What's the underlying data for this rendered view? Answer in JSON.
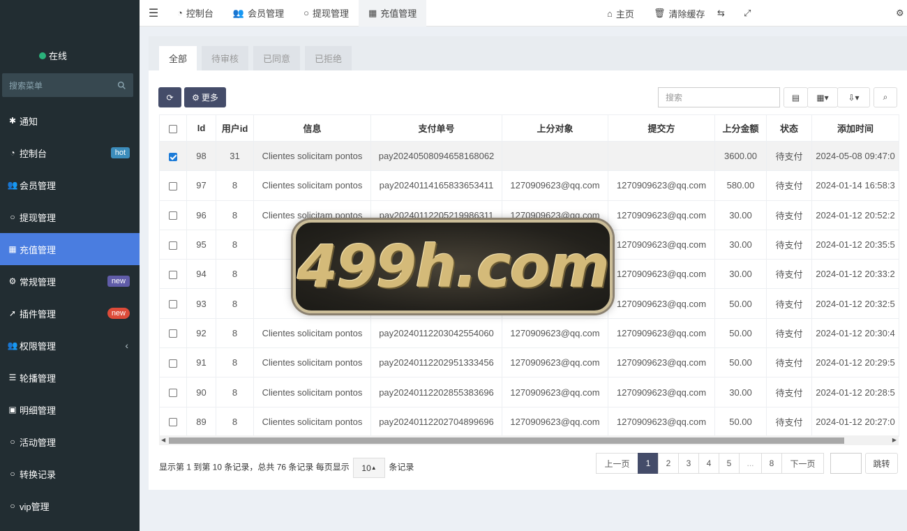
{
  "sidebar": {
    "status_label": "在线",
    "search_placeholder": "搜索菜单",
    "items": [
      {
        "label": "通知",
        "icon": "asterisk-icon"
      },
      {
        "label": "控制台",
        "icon": "dashboard-icon",
        "badge": "hot"
      },
      {
        "label": "会员管理",
        "icon": "users-icon"
      },
      {
        "label": "提现管理",
        "icon": "circle-icon"
      },
      {
        "label": "充值管理",
        "icon": "grid-icon",
        "active": true
      },
      {
        "label": "常规管理",
        "icon": "cogs-icon",
        "badge": "new"
      },
      {
        "label": "插件管理",
        "icon": "rocket-icon",
        "badge": "new"
      },
      {
        "label": "权限管理",
        "icon": "users-icon",
        "arrow": "‹"
      },
      {
        "label": "轮播管理",
        "icon": "list-icon"
      },
      {
        "label": "明细管理",
        "icon": "calendar-icon"
      },
      {
        "label": "活动管理",
        "icon": "circle-icon"
      },
      {
        "label": "转换记录",
        "icon": "circle-icon"
      },
      {
        "label": "vip管理",
        "icon": "circle-icon"
      }
    ]
  },
  "topbar": {
    "tabs": [
      "控制台",
      "会员管理",
      "提现管理",
      "充值管理"
    ],
    "home": "主页",
    "clear_cache": "清除缓存"
  },
  "panel": {
    "tabs": [
      "全部",
      "待审核",
      "已同意",
      "已拒绝"
    ],
    "more_button": "更多",
    "search_placeholder": "搜索"
  },
  "table": {
    "headers": [
      "Id",
      "用户id",
      "信息",
      "支付单号",
      "上分对象",
      "提交方",
      "上分金额",
      "状态",
      "添加时间"
    ],
    "rows": [
      {
        "id": "98",
        "uid": "31",
        "info": "Clientes solicitam pontos",
        "order": "pay20240508094658168062",
        "target": "",
        "submitter": "",
        "amount": "3600.00",
        "status": "待支付",
        "time": "2024-05-08 09:47:0",
        "checked": true
      },
      {
        "id": "97",
        "uid": "8",
        "info": "Clientes solicitam pontos",
        "order": "pay20240114165833653411",
        "target": "1270909623@qq.com",
        "submitter": "1270909623@qq.com",
        "amount": "580.00",
        "status": "待支付",
        "time": "2024-01-14 16:58:3"
      },
      {
        "id": "96",
        "uid": "8",
        "info": "Clientes solicitam pontos",
        "order": "pay20240112205219986311",
        "target": "1270909623@qq.com",
        "submitter": "1270909623@qq.com",
        "amount": "30.00",
        "status": "待支付",
        "time": "2024-01-12 20:52:2"
      },
      {
        "id": "95",
        "uid": "8",
        "info": "Cliente",
        "order": "",
        "target": "",
        "submitter": "1270909623@qq.com",
        "amount": "30.00",
        "status": "待支付",
        "time": "2024-01-12 20:35:5"
      },
      {
        "id": "94",
        "uid": "8",
        "info": "Cliente",
        "order": "",
        "target": "",
        "submitter": "1270909623@qq.com",
        "amount": "30.00",
        "status": "待支付",
        "time": "2024-01-12 20:33:2"
      },
      {
        "id": "93",
        "uid": "8",
        "info": "Clientes",
        "order": "",
        "target": "",
        "submitter": "1270909623@qq.com",
        "amount": "50.00",
        "status": "待支付",
        "time": "2024-01-12 20:32:5"
      },
      {
        "id": "92",
        "uid": "8",
        "info": "Clientes solicitam pontos",
        "order": "pay20240112203042554060",
        "target": "1270909623@qq.com",
        "submitter": "1270909623@qq.com",
        "amount": "50.00",
        "status": "待支付",
        "time": "2024-01-12 20:30:4"
      },
      {
        "id": "91",
        "uid": "8",
        "info": "Clientes solicitam pontos",
        "order": "pay20240112202951333456",
        "target": "1270909623@qq.com",
        "submitter": "1270909623@qq.com",
        "amount": "50.00",
        "status": "待支付",
        "time": "2024-01-12 20:29:5"
      },
      {
        "id": "90",
        "uid": "8",
        "info": "Clientes solicitam pontos",
        "order": "pay20240112202855383696",
        "target": "1270909623@qq.com",
        "submitter": "1270909623@qq.com",
        "amount": "30.00",
        "status": "待支付",
        "time": "2024-01-12 20:28:5"
      },
      {
        "id": "89",
        "uid": "8",
        "info": "Clientes solicitam pontos",
        "order": "pay20240112202704899696",
        "target": "1270909623@qq.com",
        "submitter": "1270909623@qq.com",
        "amount": "50.00",
        "status": "待支付",
        "time": "2024-01-12 20:27:0"
      }
    ]
  },
  "footer": {
    "summary_prefix": "显示第 1 到第 10 条记录，总共 76 条记录 每页显示",
    "page_size": "10",
    "summary_suffix": "条记录",
    "prev": "上一页",
    "pages": [
      "1",
      "2",
      "3",
      "4",
      "5",
      "...",
      "8"
    ],
    "next": "下一页",
    "jump": "跳转"
  },
  "watermark": "499h.com",
  "colors": {
    "sidebar_bg": "#222d32",
    "active_menu": "#4a7de0",
    "primary_button": "#444c69"
  }
}
